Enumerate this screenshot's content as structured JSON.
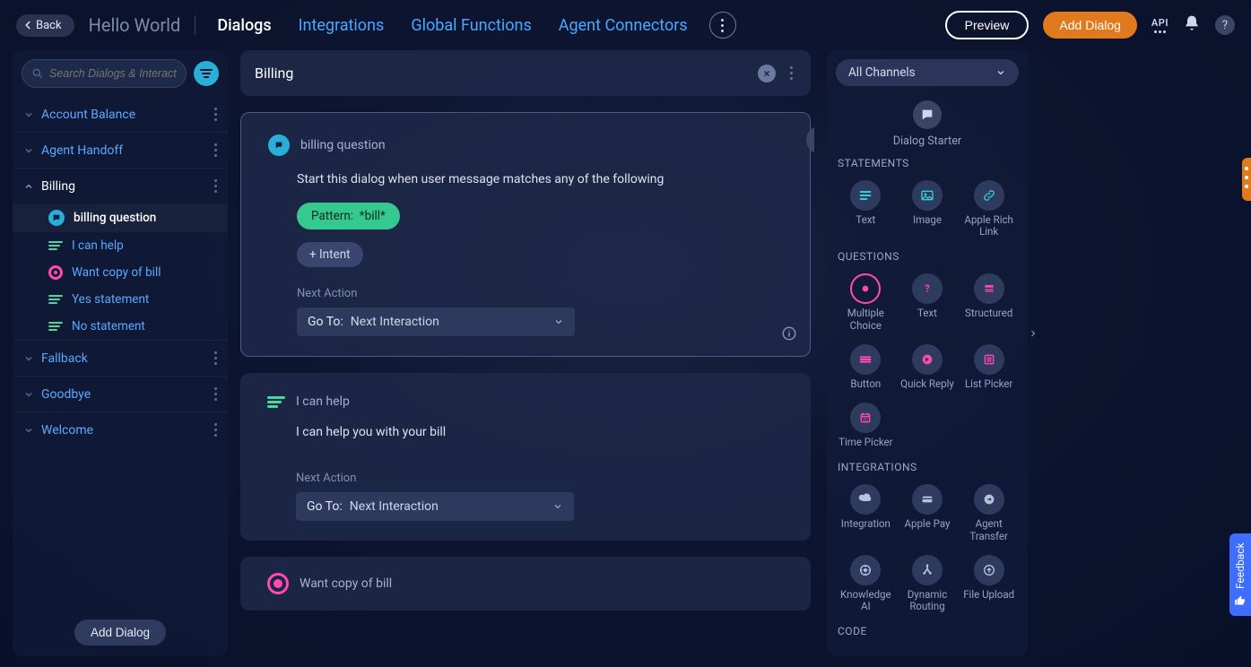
{
  "header": {
    "back": "Back",
    "app_title": "Hello World",
    "tabs": [
      "Dialogs",
      "Integrations",
      "Global Functions",
      "Agent Connectors"
    ],
    "preview": "Preview",
    "add_dialog": "Add Dialog",
    "api_label": "API"
  },
  "sidebar": {
    "search_placeholder": "Search Dialogs & Interacti...",
    "dialogs": [
      {
        "name": "Account Balance"
      },
      {
        "name": "Agent Handoff"
      },
      {
        "name": "Billing",
        "children": [
          {
            "name": "billing question",
            "type": "starter",
            "active": true
          },
          {
            "name": "I can help",
            "type": "text"
          },
          {
            "name": "Want copy of bill",
            "type": "choice"
          },
          {
            "name": "Yes statement",
            "type": "text"
          },
          {
            "name": "No statement",
            "type": "text"
          }
        ]
      },
      {
        "name": "Fallback"
      },
      {
        "name": "Goodbye"
      },
      {
        "name": "Welcome"
      }
    ],
    "add_dialog": "Add Dialog"
  },
  "main": {
    "dialog_title": "Billing",
    "cards": [
      {
        "type": "starter",
        "title": "billing question",
        "description": "Start this dialog when user message matches any of the following",
        "pattern_label": "Pattern:",
        "pattern_value": "*bill*",
        "add_intent": "+ Intent",
        "next_action_label": "Next Action",
        "goto_label": "Go To:",
        "goto_value": "Next Interaction"
      },
      {
        "type": "text",
        "title": "I can help",
        "body": "I can help you with your bill",
        "next_action_label": "Next Action",
        "goto_label": "Go To:",
        "goto_value": "Next Interaction"
      },
      {
        "type": "choice",
        "title": "Want copy of bill"
      }
    ]
  },
  "palette": {
    "channel_label": "All Channels",
    "starter_label": "Dialog Starter",
    "sections": {
      "statements": {
        "title": "STATEMENTS",
        "tools": [
          "Text",
          "Image",
          "Apple Rich Link"
        ]
      },
      "questions": {
        "title": "QUESTIONS",
        "tools": [
          "Multiple Choice",
          "Text",
          "Structured",
          "Button",
          "Quick Reply",
          "List Picker",
          "Time Picker"
        ]
      },
      "integrations": {
        "title": "INTEGRATIONS",
        "tools": [
          "Integration",
          "Apple Pay",
          "Agent Transfer",
          "Knowledge AI",
          "Dynamic Routing",
          "File Upload"
        ]
      },
      "code": {
        "title": "CODE"
      }
    }
  },
  "feedback_label": "Feedback"
}
